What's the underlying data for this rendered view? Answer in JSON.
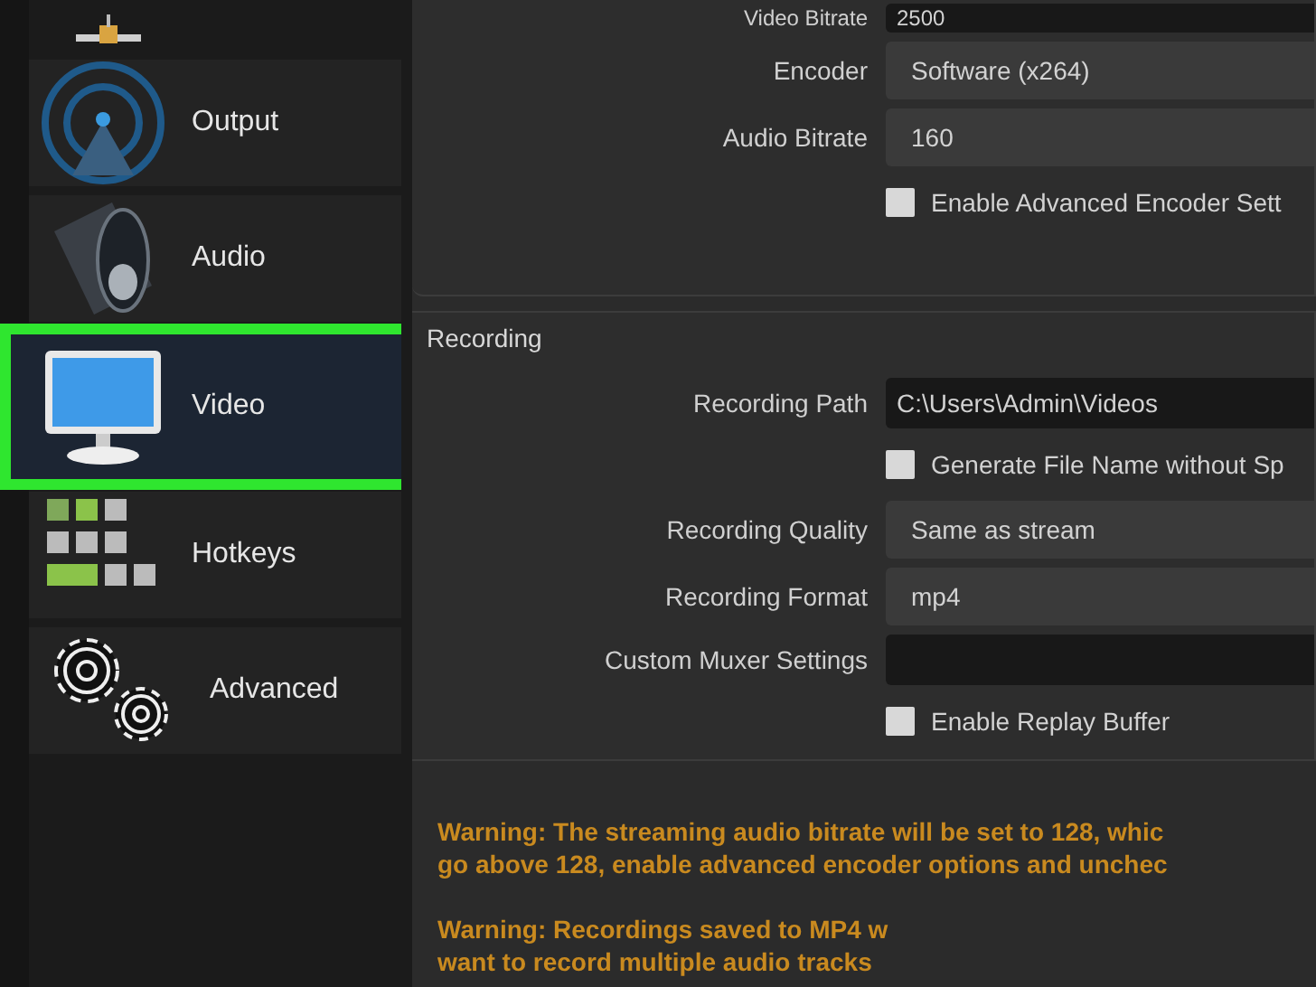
{
  "sidebar": {
    "items": [
      {
        "kind": "network",
        "selected": false
      },
      {
        "kind": "output",
        "label": "Output",
        "selected": false
      },
      {
        "kind": "audio",
        "label": "Audio",
        "selected": false
      },
      {
        "kind": "video",
        "label": "Video",
        "selected": true
      },
      {
        "kind": "hotkeys",
        "label": "Hotkeys",
        "selected": false
      },
      {
        "kind": "advanced",
        "label": "Advanced",
        "selected": false
      }
    ]
  },
  "streaming": {
    "rows": [
      {
        "kind": "text",
        "label": "Video Bitrate",
        "value": "2500"
      },
      {
        "kind": "select",
        "label": "Encoder",
        "value": "Software (x264)"
      },
      {
        "kind": "select",
        "label": "Audio Bitrate",
        "value": "160"
      },
      {
        "kind": "checkbox",
        "label": "Enable Advanced Encoder Sett",
        "checked": false
      }
    ]
  },
  "recording": {
    "title": "Recording",
    "rows": [
      {
        "kind": "text",
        "label": "Recording Path",
        "value": "C:\\Users\\Admin\\Videos"
      },
      {
        "kind": "checkbox",
        "label": "Generate File Name without Sp",
        "checked": false
      },
      {
        "kind": "select",
        "label": "Recording Quality",
        "value": "Same as stream"
      },
      {
        "kind": "select",
        "label": "Recording Format",
        "value": "mp4"
      },
      {
        "kind": "text",
        "label": "Custom Muxer Settings",
        "value": ""
      },
      {
        "kind": "checkbox",
        "label": "Enable Replay Buffer",
        "checked": false
      }
    ]
  },
  "warnings": [
    [
      "Warning: The streaming audio bitrate will be set to 128, whic",
      "go above 128, enable advanced encoder options and unchec"
    ],
    [
      "Warning: Recordings saved to MP4 w",
      "want to record multiple audio tracks"
    ]
  ]
}
